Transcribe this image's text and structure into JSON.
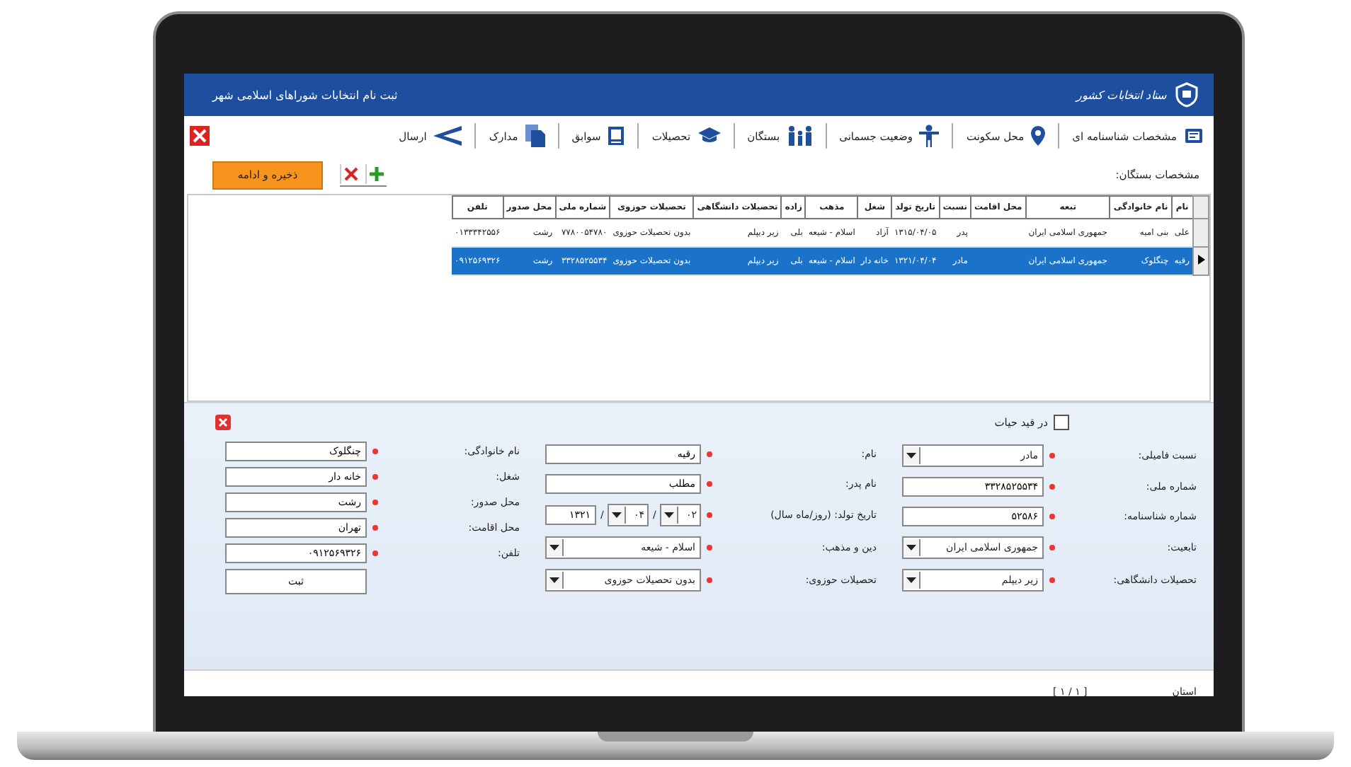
{
  "window": {
    "title": "ثبت نام انتخابات شوراهای اسلامی شهر",
    "logo_text": "ستاد انتخابات کشور"
  },
  "tabs": [
    {
      "label": "مشخصات شناسنامه ای",
      "kind": "card"
    },
    {
      "label": "محل سکونت",
      "kind": "pin"
    },
    {
      "label": "وضعیت جسمانی",
      "kind": "person"
    },
    {
      "label": "بستگان",
      "kind": "family"
    },
    {
      "label": "تحصیلات",
      "kind": "cap"
    },
    {
      "label": "سوابق",
      "kind": "doc"
    },
    {
      "label": "مدارک",
      "kind": "files"
    },
    {
      "label": "ارسال",
      "kind": "send"
    }
  ],
  "toolbar": {
    "save_button": "ذخیره و ادامه",
    "section_label": "مشخصات بستگان:"
  },
  "table": {
    "columns": [
      "نام",
      "نام خانوادگی",
      "تبعه",
      "محل اقامت",
      "نسبت",
      "تاریخ تولد",
      "شغل",
      "مذهب",
      "زاده",
      "تحصیلات دانشگاهی",
      "تحصیلات حوزوی",
      "شماره ملی",
      "محل صدور",
      "تلفن"
    ],
    "rows": [
      {
        "selected": false,
        "cells": [
          "علی",
          "بنی امیه",
          "جمهوری اسلامی ایران",
          "",
          "پدر",
          "۱۳۱۵/۰۴/۰۵",
          "آزاد",
          "اسلام - شیعه",
          "بلی",
          "زیر دیپلم",
          "بدون تحصیلات حوزوی",
          "۷۷۸۰۰۵۴۷۸۰",
          "رشت",
          "۰۱۳۳۳۴۲۵۵۶"
        ]
      },
      {
        "selected": true,
        "cells": [
          "رقیه",
          "چنگلوک",
          "جمهوری اسلامی ایران",
          "",
          "مادر",
          "۱۳۲۱/۰۴/۰۴",
          "خانه دار",
          "اسلام - شیعه",
          "بلی",
          "زیر دیپلم",
          "بدون تحصیلات حوزوی",
          "۳۳۲۸۵۲۵۵۳۴",
          "رشت",
          "۰۹۱۲۵۶۹۳۲۶"
        ]
      }
    ]
  },
  "form": {
    "alive": {
      "label": "در قید حیات",
      "checked": false
    },
    "columns": [
      [
        {
          "label": "نسبت فامیلی:",
          "kind": "select",
          "value": "مادر",
          "required": true
        },
        {
          "label": "شماره ملی:",
          "kind": "text",
          "value": "۳۳۲۸۵۲۵۵۳۴",
          "required": true
        },
        {
          "label": "شماره شناسنامه:",
          "kind": "text",
          "value": "۵۲۵۸۶",
          "required": true
        },
        {
          "label": "تابعیت:",
          "kind": "select",
          "value": "جمهوری اسلامی ایران",
          "required": true
        },
        {
          "label": "تحصیلات دانشگاهی:",
          "kind": "select",
          "value": "زیر دیپلم",
          "required": true
        }
      ],
      [
        {
          "label": "نام:",
          "kind": "text",
          "value": "رقیه",
          "required": true
        },
        {
          "label": "نام پدر:",
          "kind": "text",
          "value": "مطلب",
          "required": true
        },
        {
          "label": "تاریخ تولد: (روز/ماه سال)",
          "kind": "date",
          "separator": "/",
          "day": "۰۲",
          "month": "۰۴",
          "year": "۱۳۲۱",
          "required": true
        },
        {
          "label": "دین و مذهب:",
          "kind": "select",
          "value": "اسلام - شیعه",
          "required": true
        },
        {
          "label": "تحصیلات حوزوی:",
          "kind": "select",
          "value": "بدون تحصیلات حوزوی",
          "required": true
        }
      ],
      [
        {
          "label": "نام خانوادگی:",
          "kind": "text",
          "value": "چنگلوک",
          "required": true
        },
        {
          "label": "شغل:",
          "kind": "text",
          "value": "خانه دار",
          "required": true
        },
        {
          "label": "محل صدور:",
          "kind": "text",
          "value": "رشت",
          "required": true
        },
        {
          "label": "محل اقامت:",
          "kind": "text",
          "value": "تهران",
          "required": true
        },
        {
          "label": "تلفن:",
          "kind": "text",
          "value": "۰۹۱۲۵۶۹۳۲۶",
          "required": true
        }
      ]
    ],
    "submit_button": "ثبت"
  },
  "status_bar": {
    "label": "استان",
    "pager": "[ ۱ / ۱ ]"
  }
}
